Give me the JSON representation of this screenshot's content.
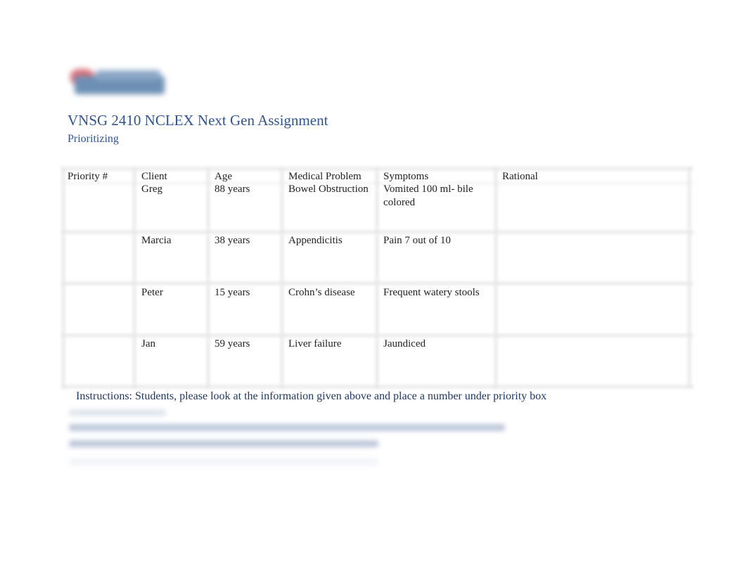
{
  "document": {
    "logo": "college-logo",
    "title": "VNSG 2410 NCLEX Next Gen Assignment",
    "subtitle": "Prioritizing"
  },
  "table": {
    "columns": [
      "Priority #",
      "Client",
      "Age",
      "Medical Problem",
      "Symptoms",
      "Rational"
    ],
    "rows": [
      {
        "priority": "",
        "client": "Greg",
        "age": "88 years",
        "problem": "Bowel Obstruction",
        "symptoms": [
          "Vomited 100 ml- bile",
          "colored"
        ],
        "rational": ""
      },
      {
        "priority": "",
        "client": "Marcia",
        "age": "38 years",
        "problem": "Appendicitis",
        "symptoms": [
          "Pain 7 out of 10"
        ],
        "rational": ""
      },
      {
        "priority": "",
        "client": "Peter",
        "age": "15 years",
        "problem": "Crohn’s disease",
        "symptoms": [
          "Frequent watery stools"
        ],
        "rational": ""
      },
      {
        "priority": "",
        "client": "Jan",
        "age": "59 years",
        "problem": "Liver failure",
        "symptoms": [
          "Jaundiced"
        ],
        "rational": ""
      }
    ]
  },
  "instructions": {
    "text": "Instructions: Students, please look at the information given above and place a number under priority box"
  },
  "colors": {
    "heading": "#2f5496",
    "instructions": "#1f3864"
  }
}
